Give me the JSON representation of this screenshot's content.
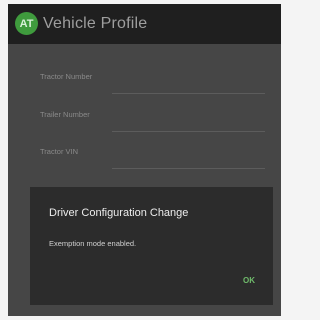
{
  "app_bar": {
    "logo_text": "AT",
    "title": "Vehicle Profile"
  },
  "form": {
    "fields": [
      {
        "label": "Tractor Number",
        "value": ""
      },
      {
        "label": "Trailer Number",
        "value": ""
      },
      {
        "label": "Tractor VIN",
        "value": ""
      }
    ]
  },
  "dialog": {
    "title": "Driver Configuration Change",
    "message": "Exemption mode enabled.",
    "ok_label": "OK"
  },
  "colors": {
    "accent": "#6fba6b",
    "logo": "#3f9b3d",
    "app_bar": "#1f1f1f",
    "dialog_bg": "#2c2c2c"
  }
}
